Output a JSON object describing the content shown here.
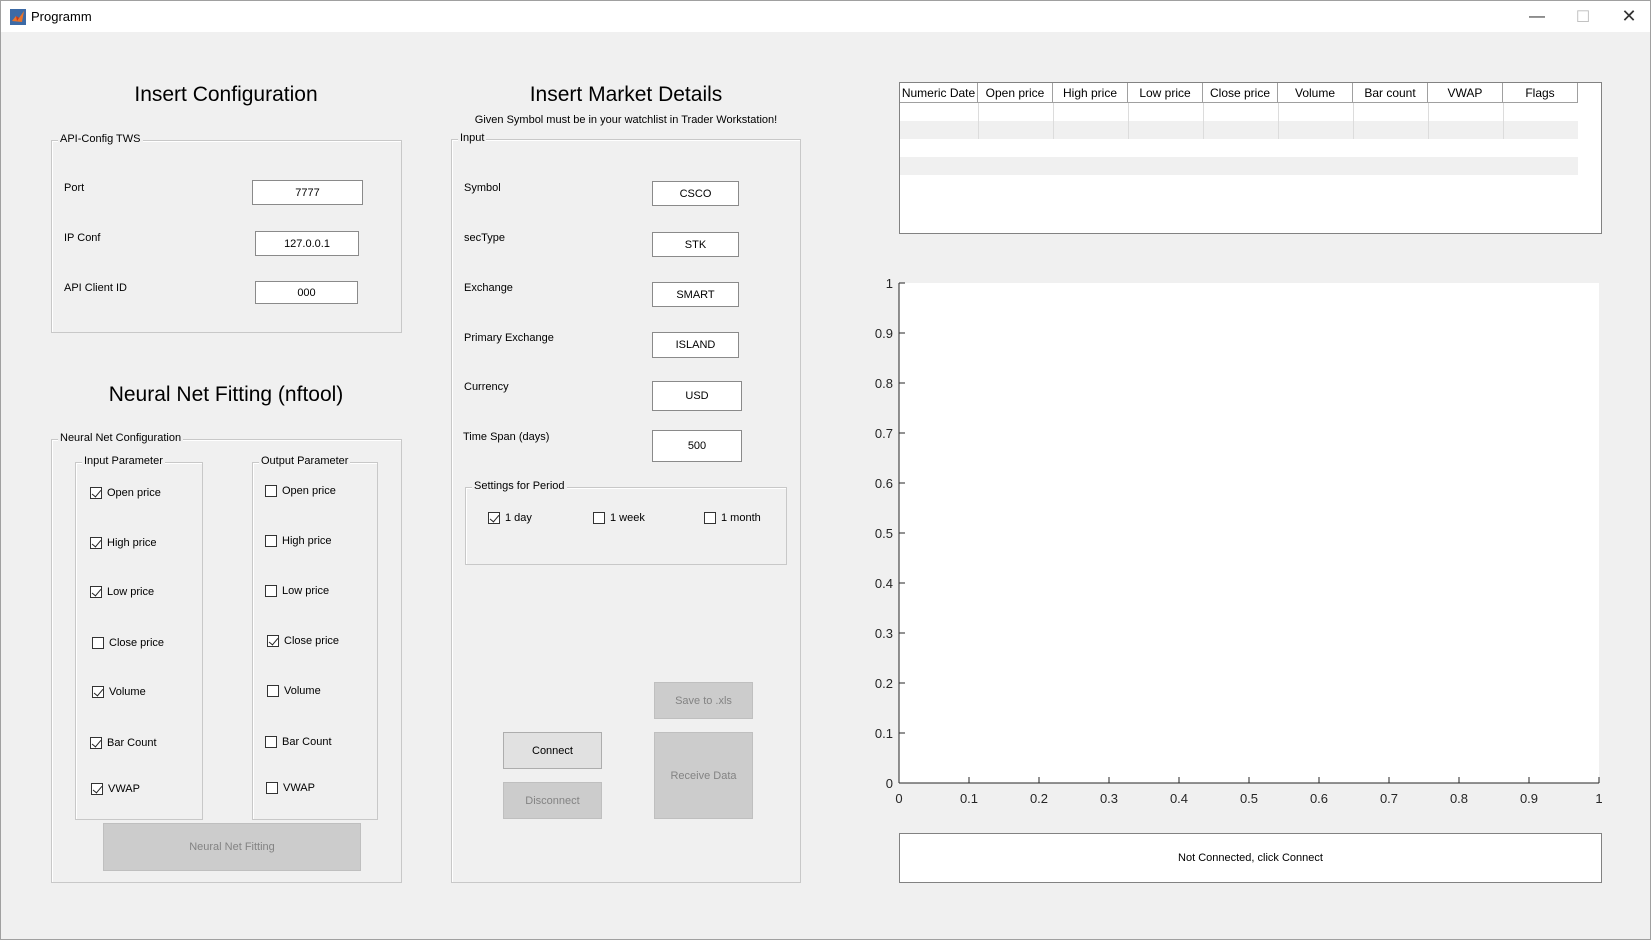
{
  "window": {
    "title": "Programm"
  },
  "config": {
    "heading": "Insert Configuration",
    "group": "API-Config TWS",
    "port_label": "Port",
    "port_value": "7777",
    "ip_label": "IP Conf",
    "ip_value": "127.0.0.1",
    "client_label": "API Client ID",
    "client_value": "000"
  },
  "nn": {
    "heading": "Neural Net Fitting (nftool)",
    "group": "Neural Net Configuration",
    "input_group": "Input Parameter",
    "output_group": "Output Parameter",
    "input_params": [
      {
        "label": "Open price",
        "checked": true
      },
      {
        "label": "High price",
        "checked": true
      },
      {
        "label": "Low price",
        "checked": true
      },
      {
        "label": "Close price",
        "checked": false
      },
      {
        "label": "Volume",
        "checked": true
      },
      {
        "label": "Bar Count",
        "checked": true
      },
      {
        "label": "VWAP",
        "checked": true
      }
    ],
    "output_params": [
      {
        "label": "Open price",
        "checked": false
      },
      {
        "label": "High price",
        "checked": false
      },
      {
        "label": "Low price",
        "checked": false
      },
      {
        "label": "Close price",
        "checked": true
      },
      {
        "label": "Volume",
        "checked": false
      },
      {
        "label": "Bar Count",
        "checked": false
      },
      {
        "label": "VWAP",
        "checked": false
      }
    ],
    "fit_button": "Neural Net Fitting"
  },
  "market": {
    "heading": "Insert Market Details",
    "note": "Given Symbol must be in your watchlist in Trader Workstation!",
    "group": "Input",
    "symbol_label": "Symbol",
    "symbol_value": "CSCO",
    "sectype_label": "secType",
    "sectype_value": "STK",
    "exchange_label": "Exchange",
    "exchange_value": "SMART",
    "primary_label": "Primary Exchange",
    "primary_value": "ISLAND",
    "currency_label": "Currency",
    "currency_value": "USD",
    "timespan_label": "Time Span (days)",
    "timespan_value": "500",
    "period_group": "Settings for Period",
    "periods": [
      {
        "label": "1 day",
        "checked": true
      },
      {
        "label": "1 week",
        "checked": false
      },
      {
        "label": "1 month",
        "checked": false
      }
    ],
    "save_button": "Save to .xls",
    "connect_button": "Connect",
    "disconnect_button": "Disconnect",
    "receive_button": "Receive Data"
  },
  "table": {
    "columns": [
      "Numeric Date",
      "Open price",
      "High price",
      "Low price",
      "Close price",
      "Volume",
      "Bar count",
      "VWAP",
      "Flags"
    ]
  },
  "status_text": "Not Connected, click Connect",
  "chart_data": {
    "type": "line",
    "series": [],
    "xlim": [
      0,
      1
    ],
    "ylim": [
      0,
      1
    ],
    "xticks": [
      "0",
      "0.1",
      "0.2",
      "0.3",
      "0.4",
      "0.5",
      "0.6",
      "0.7",
      "0.8",
      "0.9",
      "1"
    ],
    "yticks": [
      "0",
      "0.1",
      "0.2",
      "0.3",
      "0.4",
      "0.5",
      "0.6",
      "0.7",
      "0.8",
      "0.9",
      "1"
    ]
  }
}
